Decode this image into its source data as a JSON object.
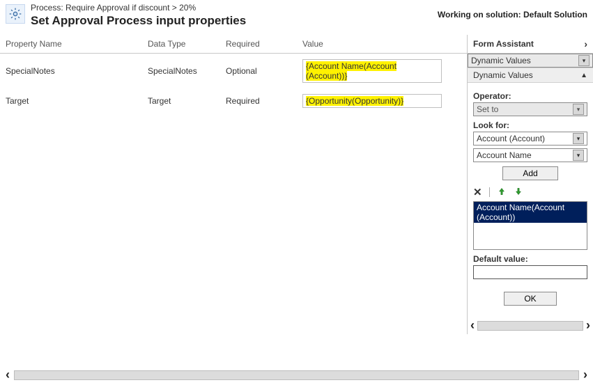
{
  "header": {
    "process_label": "Process: Require Approval if discount > 20%",
    "title": "Set Approval Process input properties",
    "working_on": "Working on solution: Default Solution"
  },
  "columns": {
    "name": "Property Name",
    "type": "Data Type",
    "required": "Required",
    "value": "Value"
  },
  "rows": [
    {
      "name": "SpecialNotes",
      "type": "SpecialNotes",
      "required": "Optional",
      "value": "{Account Name(Account (Account))}"
    },
    {
      "name": "Target",
      "type": "Target",
      "required": "Required",
      "value": "{Opportunity(Opportunity)}"
    }
  ],
  "formAssistant": {
    "title": "Form Assistant",
    "dropdown": "Dynamic Values",
    "section": "Dynamic Values",
    "operator_label": "Operator:",
    "operator_value": "Set to",
    "lookfor_label": "Look for:",
    "lookfor_entity": "Account (Account)",
    "lookfor_attr": "Account Name",
    "add_label": "Add",
    "list_item": "Account Name(Account (Account))",
    "default_label": "Default value:",
    "default_value": "",
    "ok_label": "OK"
  }
}
